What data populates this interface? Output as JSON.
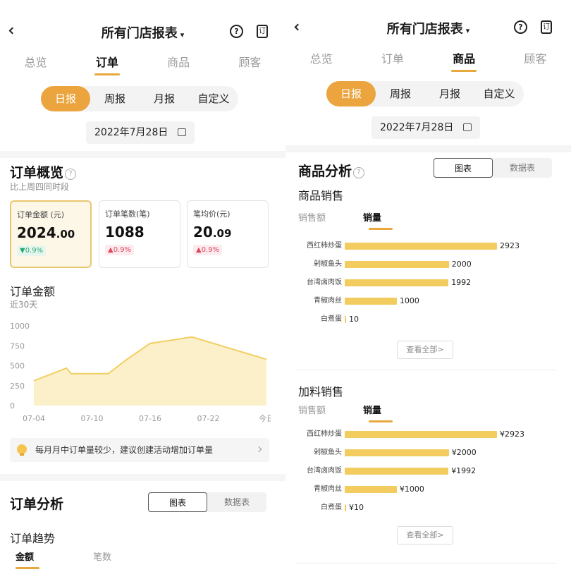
{
  "left": {
    "header": {
      "title": "所有门店报表",
      "caret": "▾",
      "help": "?",
      "calendar": "订"
    },
    "main_tabs": [
      "总览",
      "订单",
      "商品",
      "顾客"
    ],
    "period_tabs": [
      "日报",
      "周报",
      "月报",
      "自定义"
    ],
    "date": "2022年7月28日",
    "overview": {
      "title": "订单概览",
      "help": "?",
      "subtitle": "比上周四同时段",
      "cards": [
        {
          "label": "订单金额 (元)",
          "value_main": "2024",
          "value_decimal": ".00",
          "delta": "▼0.9%",
          "direction": "down"
        },
        {
          "label": "订单笔数(笔)",
          "value_main": "1088",
          "value_decimal": "",
          "delta": "▲0.9%",
          "direction": "up"
        },
        {
          "label": "笔均价(元)",
          "value_main": "20",
          "value_decimal": ".09",
          "delta": "▲0.9%",
          "direction": "up"
        }
      ]
    },
    "amount": {
      "title": "订单金额",
      "subtitle": "近30天",
      "chart_data": {
        "type": "area",
        "title": "订单金额",
        "x_tick_labels": [
          "07-04",
          "07-10",
          "07-16",
          "07-22",
          "今日"
        ],
        "y_ticks": [
          0,
          250,
          500,
          750,
          1000
        ],
        "ylim": [
          0,
          1000
        ],
        "x_index_range": [
          0,
          25
        ],
        "points": [
          {
            "x": 0,
            "y": 310
          },
          {
            "x": 3.5,
            "y": 470
          },
          {
            "x": 4,
            "y": 400
          },
          {
            "x": 8,
            "y": 400
          },
          {
            "x": 10,
            "y": 580
          },
          {
            "x": 12.5,
            "y": 780
          },
          {
            "x": 17,
            "y": 860
          },
          {
            "x": 25,
            "y": 580
          }
        ],
        "color": "#f2cf63"
      }
    },
    "tip": {
      "text": "每月月中订单量较少，建议创建活动增加订单量"
    },
    "analysis": {
      "title": "订单分析",
      "toggle": [
        "图表",
        "数据表"
      ],
      "trend_title": "订单趋势",
      "metric_tabs": [
        "金额",
        "笔数"
      ]
    }
  },
  "right": {
    "header": {
      "title": "所有门店报表",
      "caret": "▾",
      "help": "?",
      "calendar": "订"
    },
    "main_tabs": [
      "总览",
      "订单",
      "商品",
      "顾客"
    ],
    "period_tabs": [
      "日报",
      "周报",
      "月报",
      "自定义"
    ],
    "date": "2022年7月28日",
    "analysis": {
      "title": "商品分析",
      "help": "?",
      "toggle": [
        "图表",
        "数据表"
      ]
    },
    "product_sales": {
      "title": "商品销售",
      "metric_tabs": [
        "销售额",
        "销量"
      ],
      "more": "查看全部>",
      "chart_data": {
        "type": "bar",
        "orientation": "horizontal",
        "categories": [
          "西红柿炒蛋",
          "剁椒鱼头",
          "台湾卤肉饭",
          "青椒肉丝",
          "白煮蛋"
        ],
        "values": [
          2923,
          2000,
          1992,
          1000,
          10
        ],
        "value_labels": [
          "2923",
          "2000",
          "1992",
          "1000",
          "10"
        ],
        "color": "#f3cc5f"
      }
    },
    "addon_sales": {
      "title": "加料销售",
      "metric_tabs": [
        "销售额",
        "销量"
      ],
      "more": "查看全部>",
      "chart_data": {
        "type": "bar",
        "orientation": "horizontal",
        "categories": [
          "西红柿炒蛋",
          "剁椒鱼头",
          "台湾卤肉饭",
          "青椒肉丝",
          "白煮蛋"
        ],
        "values": [
          2923,
          2000,
          1992,
          1000,
          10
        ],
        "value_labels": [
          "¥2923",
          "¥2000",
          "¥1992",
          "¥1000",
          "¥10"
        ],
        "color": "#f3cc5f"
      }
    }
  }
}
